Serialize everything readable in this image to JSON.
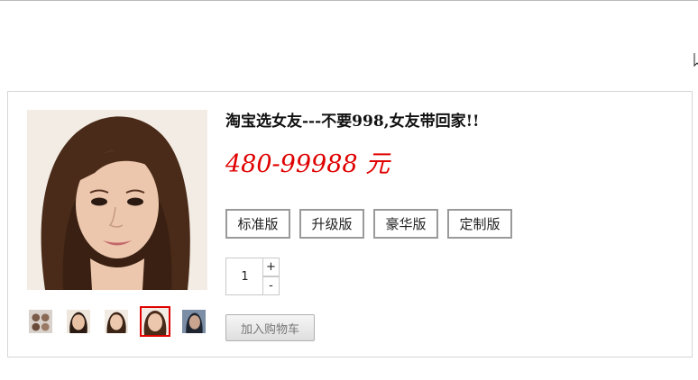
{
  "product": {
    "title": "淘宝选女友---不要998,女友带回家!!",
    "price_text": "480-99988 元",
    "price_color": "#e00000"
  },
  "gallery": {
    "main_image_icon": "portrait-photo",
    "thumbnails": [
      {
        "name": "thumbnail-1",
        "selected": false
      },
      {
        "name": "thumbnail-2",
        "selected": false
      },
      {
        "name": "thumbnail-3",
        "selected": false
      },
      {
        "name": "thumbnail-4",
        "selected": true
      },
      {
        "name": "thumbnail-5",
        "selected": false
      }
    ],
    "selected_border_color": "#e00000"
  },
  "versions": [
    "标准版",
    "升级版",
    "豪华版",
    "定制版"
  ],
  "quantity": {
    "value": "1",
    "plus_label": "+",
    "minus_label": "-"
  },
  "cart": {
    "add_label": "加入购物车"
  }
}
